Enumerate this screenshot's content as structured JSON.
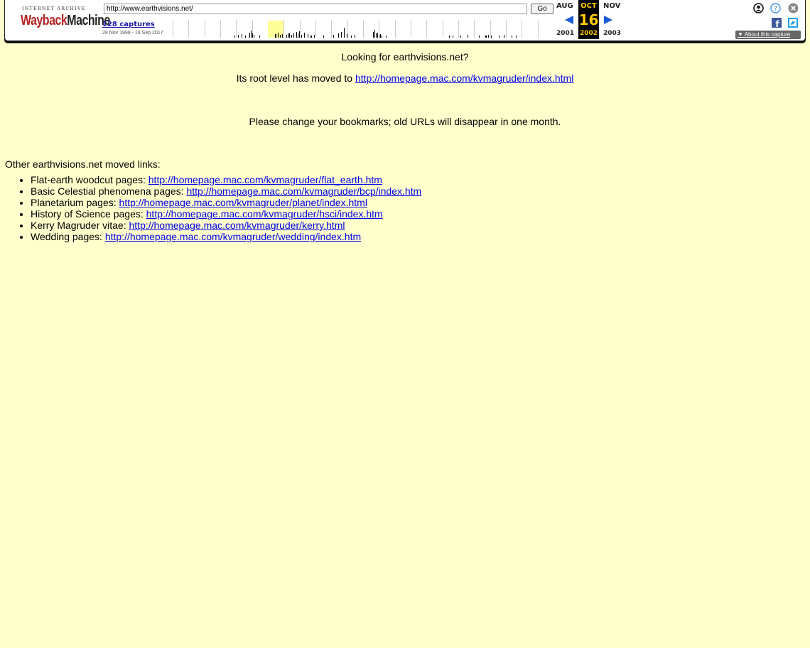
{
  "wayback": {
    "logo_top": "INTERNET ARCHIVE",
    "logo_wayback": "Wayback",
    "logo_machine": "Machine",
    "url_value": "http://www.earthvisions.net/",
    "go_label": "Go",
    "captures_label": "128 captures",
    "captures_range": "28 Nov 1999 - 16 Sep 2017",
    "nav": {
      "prev_month": "AUG",
      "current_month": "OCT",
      "next_month": "NOV",
      "current_day": "16",
      "prev_year": "2001",
      "current_year": "2002",
      "next_year": "2003"
    },
    "about_label": "▼ About this capture",
    "icons": [
      "user-icon",
      "help-icon",
      "close-icon",
      "facebook-icon",
      "twitter-icon"
    ],
    "accent_color": "#ffcc00",
    "arrow_color": "#1a5bd8"
  },
  "page": {
    "title_line": "Looking for earthvisions.net?",
    "moved_prefix": "Its root level has moved to ",
    "moved_link": "http://homepage.mac.com/kvmagruder/index.html",
    "bookmark_line": "Please change your bookmarks; old URLs will disappear in one month.",
    "other_heading": "Other earthvisions.net moved links:",
    "links": [
      {
        "label": "Flat-earth woodcut pages: ",
        "url": "http://homepage.mac.com/kvmagruder/flat_earth.htm"
      },
      {
        "label": "Basic Celestial phenomena pages: ",
        "url": "http://homepage.mac.com/kvmagruder/bcp/index.htm"
      },
      {
        "label": "Planetarium pages: ",
        "url": "http://homepage.mac.com/kvmagruder/planet/index.html"
      },
      {
        "label": "History of Science pages: ",
        "url": "http://homepage.mac.com/kvmagruder/hsci/index.htm"
      },
      {
        "label": "Kerry Magruder vitae: ",
        "url": "http://homepage.mac.com/kvmagruder/kerry.html"
      },
      {
        "label": "Wedding pages: ",
        "url": "http://homepage.mac.com/kvmagruder/wedding/index.htm"
      }
    ],
    "background_color": "#ffffcc",
    "link_color": "#0000ee"
  }
}
